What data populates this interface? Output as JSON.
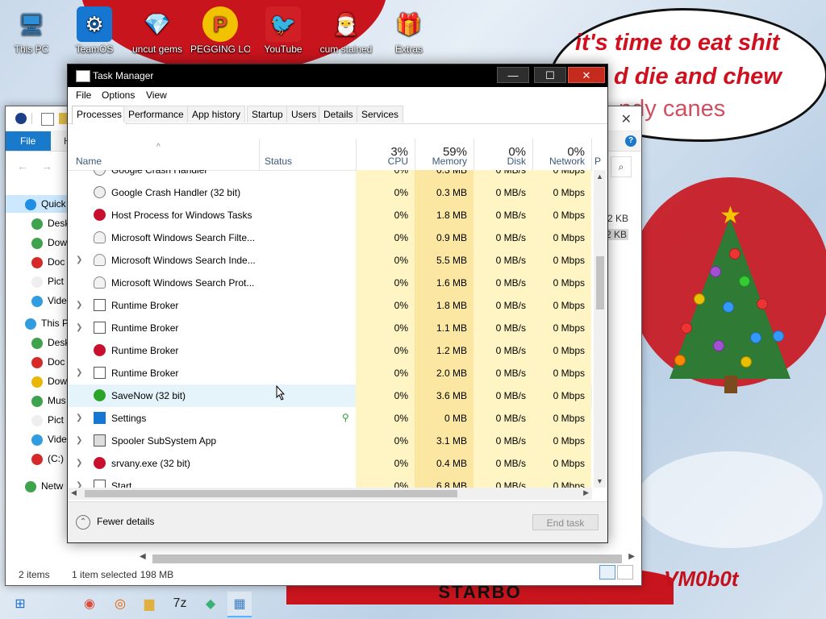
{
  "desktop": {
    "icons": [
      {
        "label": "This PC",
        "glyph": "🖥",
        "color": "#2f8fd9"
      },
      {
        "label": "TeamOS",
        "glyph": "⚙",
        "color": "#1677d2"
      },
      {
        "label": "uncut gems",
        "glyph": "💎",
        "color": "#26c0d6"
      },
      {
        "label": "PEGGING LOL",
        "glyph": "P",
        "color": "#e94b2c"
      },
      {
        "label": "YouTube",
        "glyph": "🐦",
        "color": "#d11f26"
      },
      {
        "label": "cum stained",
        "glyph": "🎅",
        "color": "#f07a17"
      },
      {
        "label": "Extras",
        "glyph": "🎁",
        "color": "#c9202a"
      }
    ],
    "speech_lines": [
      "it's time to eat shit",
      "d die and chew",
      "ndy canes"
    ],
    "signature": "VM0b0t",
    "banner_text": "STARBO"
  },
  "explorer": {
    "ribbon_tab_file": "File",
    "ribbon_tab_home_partial": "H",
    "help_glyph": "?",
    "close_glyph": "✕",
    "back_glyph": "←",
    "forward_glyph": "→",
    "search_glyph": "⌕",
    "nav_items": [
      {
        "label": "Quick",
        "color": "#1f8fe6",
        "selected": true
      },
      {
        "label": "Desk",
        "color": "#3fa34d"
      },
      {
        "label": "Dow",
        "color": "#3fa34d"
      },
      {
        "label": "Doc",
        "color": "#d62a2a"
      },
      {
        "label": "Pict",
        "color": "#eee"
      },
      {
        "label": "Vide",
        "color": "#2f9de0"
      },
      {
        "label": "This P",
        "color": "#2f9de0"
      },
      {
        "label": "Desk",
        "color": "#3fa34d"
      },
      {
        "label": "Doc",
        "color": "#d62a2a"
      },
      {
        "label": "Dow",
        "color": "#e8b900"
      },
      {
        "label": "Mus",
        "color": "#3fa34d"
      },
      {
        "label": "Pict",
        "color": "#eee"
      },
      {
        "label": "Vide",
        "color": "#2f9de0"
      },
      {
        "label": "(C:)",
        "color": "#d62a2a"
      },
      {
        "label": "Netw",
        "color": "#3fa34d"
      }
    ],
    "sizes": [
      "2 KB",
      "2 KB"
    ],
    "status": {
      "items": "2 items",
      "selected": "1 item selected",
      "size": "198 MB"
    }
  },
  "taskmanager": {
    "title": "Task Manager",
    "window_buttons": {
      "minimize": "—",
      "maximize": "☐",
      "close": "✕"
    },
    "menu": [
      "File",
      "Options",
      "View"
    ],
    "tabs": [
      "Processes",
      "Performance",
      "App history",
      "Startup",
      "Users",
      "Details",
      "Services"
    ],
    "active_tab": "Processes",
    "columns": {
      "name": "Name",
      "status": "Status",
      "cpu": {
        "pct": "3%",
        "label": "CPU"
      },
      "memory": {
        "pct": "59%",
        "label": "Memory"
      },
      "disk": {
        "pct": "0%",
        "label": "Disk"
      },
      "network": {
        "pct": "0%",
        "label": "Network"
      },
      "power_partial": "P"
    },
    "sort_indicator": "^",
    "processes": [
      {
        "name": "Google Crash Handler",
        "expand": false,
        "icon": "gear",
        "cpu": "0%",
        "mem": "0.3 MB",
        "disk": "0 MB/s",
        "net": "0 Mbps",
        "partial": true
      },
      {
        "name": "Google Crash Handler (32 bit)",
        "expand": false,
        "icon": "gear",
        "cpu": "0%",
        "mem": "0.3 MB",
        "disk": "0 MB/s",
        "net": "0 Mbps"
      },
      {
        "name": "Host Process for Windows Tasks",
        "expand": false,
        "icon": "red",
        "cpu": "0%",
        "mem": "1.8 MB",
        "disk": "0 MB/s",
        "net": "0 Mbps"
      },
      {
        "name": "Microsoft Windows Search Filte...",
        "expand": false,
        "icon": "person",
        "cpu": "0%",
        "mem": "0.9 MB",
        "disk": "0 MB/s",
        "net": "0 Mbps"
      },
      {
        "name": "Microsoft Windows Search Inde...",
        "expand": true,
        "icon": "person",
        "cpu": "0%",
        "mem": "5.5 MB",
        "disk": "0 MB/s",
        "net": "0 Mbps"
      },
      {
        "name": "Microsoft Windows Search Prot...",
        "expand": false,
        "icon": "person",
        "cpu": "0%",
        "mem": "1.6 MB",
        "disk": "0 MB/s",
        "net": "0 Mbps"
      },
      {
        "name": "Runtime Broker",
        "expand": true,
        "icon": "box",
        "cpu": "0%",
        "mem": "1.8 MB",
        "disk": "0 MB/s",
        "net": "0 Mbps"
      },
      {
        "name": "Runtime Broker",
        "expand": true,
        "icon": "box",
        "cpu": "0%",
        "mem": "1.1 MB",
        "disk": "0 MB/s",
        "net": "0 Mbps"
      },
      {
        "name": "Runtime Broker",
        "expand": false,
        "icon": "red",
        "cpu": "0%",
        "mem": "1.2 MB",
        "disk": "0 MB/s",
        "net": "0 Mbps"
      },
      {
        "name": "Runtime Broker",
        "expand": true,
        "icon": "box",
        "cpu": "0%",
        "mem": "2.0 MB",
        "disk": "0 MB/s",
        "net": "0 Mbps"
      },
      {
        "name": "SaveNow (32 bit)",
        "expand": false,
        "icon": "dollar",
        "cpu": "0%",
        "mem": "3.6 MB",
        "disk": "0 MB/s",
        "net": "0 Mbps",
        "highlight": true
      },
      {
        "name": "Settings",
        "expand": true,
        "icon": "settings",
        "cpu": "0%",
        "mem": "0 MB",
        "disk": "0 MB/s",
        "net": "0 Mbps",
        "leaf": true
      },
      {
        "name": "Spooler SubSystem App",
        "expand": true,
        "icon": "printer",
        "cpu": "0%",
        "mem": "3.1 MB",
        "disk": "0 MB/s",
        "net": "0 Mbps"
      },
      {
        "name": "srvany.exe (32 bit)",
        "expand": true,
        "icon": "red",
        "cpu": "0%",
        "mem": "0.4 MB",
        "disk": "0 MB/s",
        "net": "0 Mbps"
      },
      {
        "name": "Start",
        "expand": true,
        "icon": "box",
        "cpu": "0%",
        "mem": "6.8 MB",
        "disk": "0 MB/s",
        "net": "0 Mbps",
        "partial": true
      }
    ],
    "footer": {
      "fewer_details": "Fewer details",
      "fewer_glyph": "⌃",
      "end_task": "End task"
    },
    "leaf_glyph": "⚲"
  },
  "taskbar": {
    "items": [
      {
        "name": "start",
        "glyph": "⊞",
        "color": "#1d6fd1"
      },
      {
        "name": "chrome",
        "glyph": "◉",
        "color": "#dd4b39"
      },
      {
        "name": "firefox",
        "glyph": "◎",
        "color": "#e66000"
      },
      {
        "name": "file-explorer",
        "glyph": "▆",
        "color": "#e0b040"
      },
      {
        "name": "7zip",
        "glyph": "7z",
        "color": "#222"
      },
      {
        "name": "app",
        "glyph": "◆",
        "color": "#3bb273"
      },
      {
        "name": "task-manager",
        "glyph": "▦",
        "color": "#3c7fc5",
        "active": true
      }
    ]
  }
}
